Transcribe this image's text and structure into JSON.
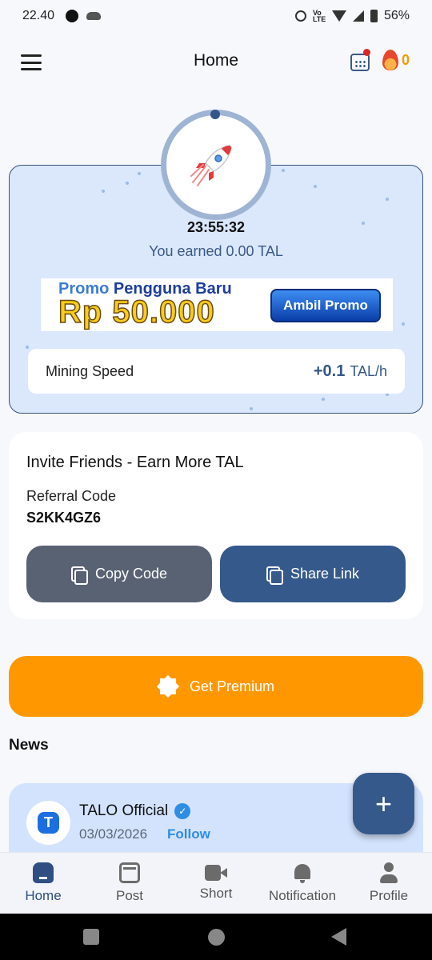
{
  "status_bar": {
    "time": "22.40",
    "battery": "56%"
  },
  "header": {
    "title": "Home",
    "streak_count": "0"
  },
  "mining": {
    "timer": "23:55:32",
    "earned_text": "You earned 0.00 TAL",
    "promo": {
      "line1_a": "Promo",
      "line1_b": "Pengguna Baru",
      "line2": "Rp 50.000",
      "button": "Ambil Promo"
    },
    "speed_label": "Mining Speed",
    "speed_value": "+0.1",
    "speed_unit": "TAL/h"
  },
  "invite": {
    "title": "Invite Friends - Earn More TAL",
    "referral_label": "Referral Code",
    "referral_code": "S2KK4GZ6",
    "copy_button": "Copy Code",
    "share_button": "Share Link"
  },
  "premium_button": "Get Premium",
  "news": {
    "title": "News",
    "post": {
      "avatar_letter": "T",
      "author": "TALO Official",
      "date": "03/03/2026",
      "follow": "Follow"
    }
  },
  "fab_label": "+",
  "bottom_nav": [
    {
      "label": "Home",
      "icon": "home-icon",
      "active": true
    },
    {
      "label": "Post",
      "icon": "post-icon",
      "active": false
    },
    {
      "label": "Short",
      "icon": "video-icon",
      "active": false
    },
    {
      "label": "Notification",
      "icon": "bell-icon",
      "active": false
    },
    {
      "label": "Profile",
      "icon": "profile-icon",
      "active": false
    }
  ],
  "colors": {
    "primary": "#35598b",
    "premium": "#ff9800",
    "accent": "#2f8de4",
    "card": "#dbe7fb"
  }
}
